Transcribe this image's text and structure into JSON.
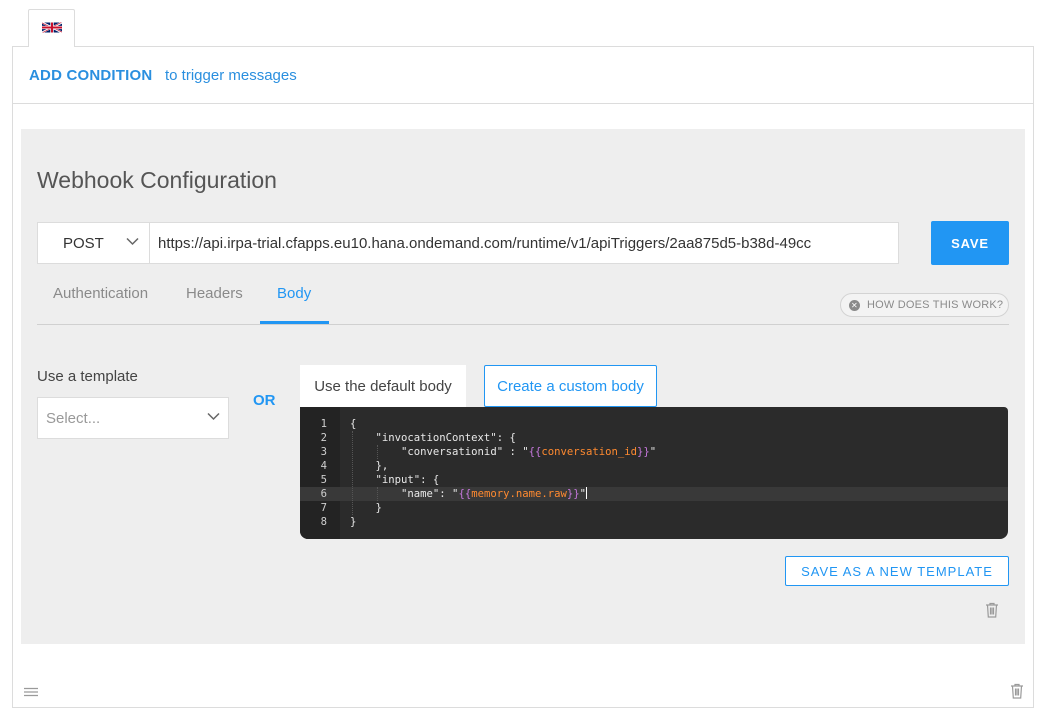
{
  "language_tab": {
    "icon": "uk-flag-icon"
  },
  "condition": {
    "add_label": "ADD CONDITION",
    "sub_label": "to trigger messages"
  },
  "webhook": {
    "title": "Webhook Configuration",
    "method": "POST",
    "url": "https://api.irpa-trial.cfapps.eu10.hana.ondemand.com/runtime/v1/apiTriggers/2aa875d5-b38d-49cc",
    "save_label": "SAVE",
    "tabs": [
      {
        "label": "Authentication",
        "active": false
      },
      {
        "label": "Headers",
        "active": false
      },
      {
        "label": "Body",
        "active": true
      }
    ],
    "help_label": "HOW DOES THIS WORK?"
  },
  "body_config": {
    "template_label": "Use a template",
    "template_placeholder": "Select...",
    "or_label": "OR",
    "default_body_label": "Use the default body",
    "custom_body_label": "Create a custom body",
    "code_lines": [
      {
        "n": "1",
        "text": "{"
      },
      {
        "n": "2",
        "text": "    \"invocationContext\": {"
      },
      {
        "n": "3",
        "pre": "        \"conversationid\" : \"",
        "tpl_open": "{{",
        "var": "conversation_id",
        "tpl_close": "}}",
        "post": "\""
      },
      {
        "n": "4",
        "text": "    },"
      },
      {
        "n": "5",
        "text": "    \"input\": {"
      },
      {
        "n": "6",
        "pre": "        \"name\": \"",
        "tpl_open": "{{",
        "var": "memory.name.raw",
        "tpl_close": "}}",
        "post": "\""
      },
      {
        "n": "7",
        "text": "    }"
      },
      {
        "n": "8",
        "text": "}"
      }
    ],
    "active_line": 6,
    "save_template_label": "SAVE AS A NEW TEMPLATE"
  },
  "colors": {
    "accent": "#2196f3",
    "panel_bg": "#eeeeee",
    "editor_bg": "#2b2b2b",
    "template_braces": "#c678dd",
    "template_var": "#ff8a30"
  }
}
